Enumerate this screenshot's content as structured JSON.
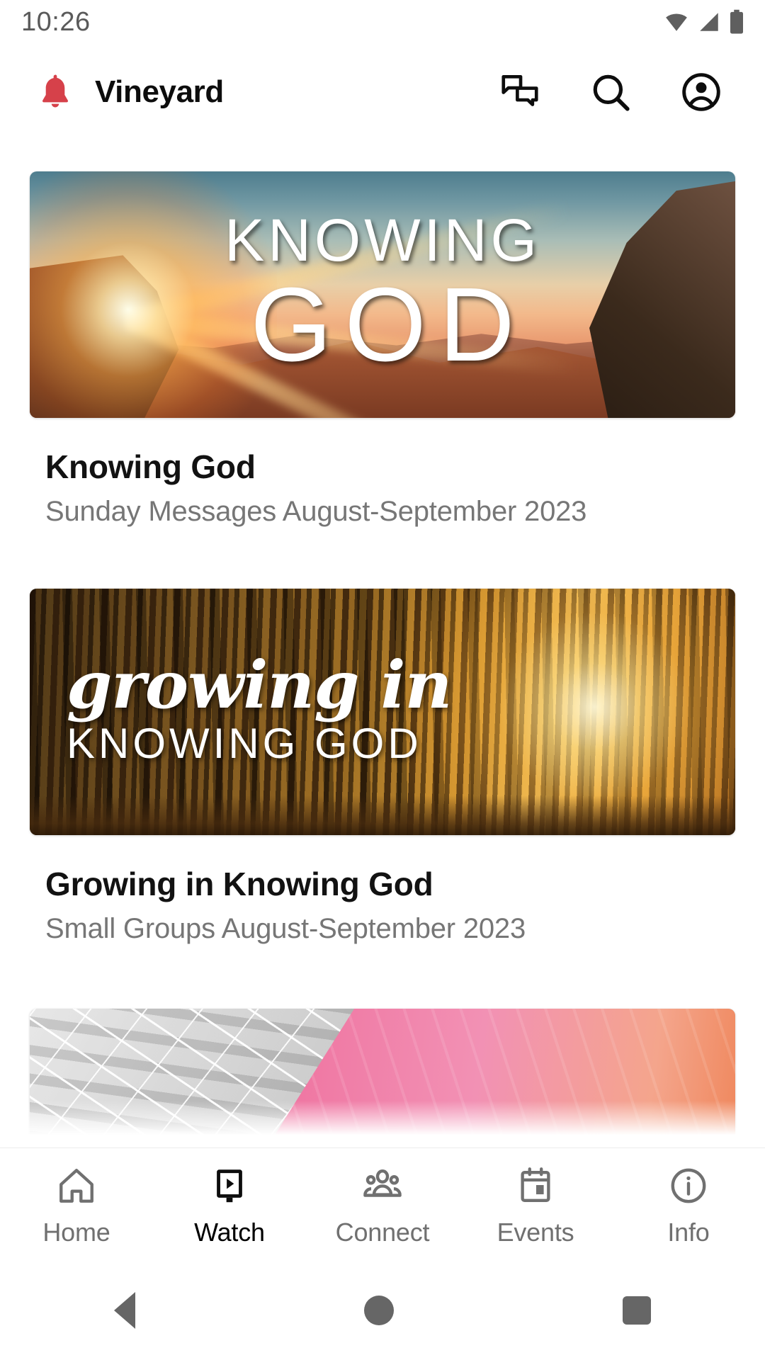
{
  "status_bar": {
    "time": "10:26",
    "icons": [
      "wifi-icon",
      "cellular-signal-icon",
      "battery-icon"
    ]
  },
  "app_bar": {
    "logo_icon": "bell-icon",
    "logo_color": "#d6414a",
    "title": "Vineyard",
    "actions": [
      {
        "name": "chat-icon",
        "label": "Chat"
      },
      {
        "name": "search-icon",
        "label": "Search"
      },
      {
        "name": "account-icon",
        "label": "Account"
      }
    ]
  },
  "series_list": [
    {
      "title": "Knowing God",
      "subtitle": "Sunday Messages August-September 2023",
      "artwork": {
        "kind": "mountain-sunrise",
        "overlay_line1": "KNOWING",
        "overlay_line2": "GOD"
      }
    },
    {
      "title": "Growing in Knowing God",
      "subtitle": "Small Groups August-September 2023",
      "artwork": {
        "kind": "redwood-forest",
        "overlay_line1": "growing in",
        "overlay_line2": "KNOWING GOD"
      }
    },
    {
      "title": "",
      "subtitle": "",
      "artwork": {
        "kind": "map-pink",
        "overlay_line1": "",
        "overlay_line2": ""
      }
    }
  ],
  "bottom_nav": {
    "active": "Watch",
    "items": [
      {
        "label": "Home",
        "icon": "home-icon",
        "active": false
      },
      {
        "label": "Watch",
        "icon": "watch-icon",
        "active": true
      },
      {
        "label": "Connect",
        "icon": "people-icon",
        "active": false
      },
      {
        "label": "Events",
        "icon": "calendar-icon",
        "active": false
      },
      {
        "label": "Info",
        "icon": "info-icon",
        "active": false
      }
    ]
  },
  "system_nav": {
    "back": "back-button",
    "home": "home-button",
    "recents": "recents-button"
  },
  "colors": {
    "accent": "#d6414a",
    "text_primary": "#121212",
    "text_secondary": "#767676",
    "nav_inactive": "#707070",
    "background": "#ffffff"
  }
}
